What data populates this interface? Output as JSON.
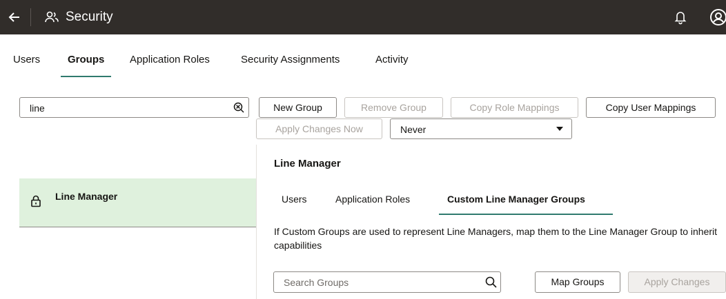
{
  "header": {
    "title": "Security",
    "back_icon": "arrow-left-icon",
    "title_icon": "users-icon",
    "notifications_icon": "bell-icon",
    "user_icon": "user-avatar-icon",
    "background": "#312d2a"
  },
  "nav": {
    "tabs": [
      {
        "label": "Users",
        "active": false
      },
      {
        "label": "Groups",
        "active": true
      },
      {
        "label": "Application Roles",
        "active": false
      },
      {
        "label": "Security Assignments",
        "active": false
      },
      {
        "label": "Activity",
        "active": false
      }
    ]
  },
  "filter": {
    "value": "line",
    "clear_icon": "clear-search-icon"
  },
  "toolbar": {
    "new_group": "New Group",
    "remove_group": "Remove Group",
    "copy_role_mappings": "Copy Role Mappings",
    "copy_user_mappings": "Copy User Mappings",
    "apply_changes_now": "Apply Changes Now",
    "schedule_value": "Never"
  },
  "groups": {
    "items": [
      {
        "label": "Line Manager",
        "icon": "lock-icon",
        "selected": true
      }
    ],
    "selected_color": "#dff1dd"
  },
  "detail": {
    "title": "Line Manager",
    "tabs": [
      {
        "label": "Users",
        "active": false
      },
      {
        "label": "Application Roles",
        "active": false
      },
      {
        "label": "Custom Line Manager Groups",
        "active": true
      }
    ],
    "description": "If Custom Groups are used to represent Line Managers, map them to the Line Manager Group to inherit capabilities",
    "search_placeholder": "Search Groups",
    "search_icon": "search-icon",
    "map_groups": "Map Groups",
    "apply_changes": "Apply Changes"
  },
  "accent_color": "#2f7a6e"
}
